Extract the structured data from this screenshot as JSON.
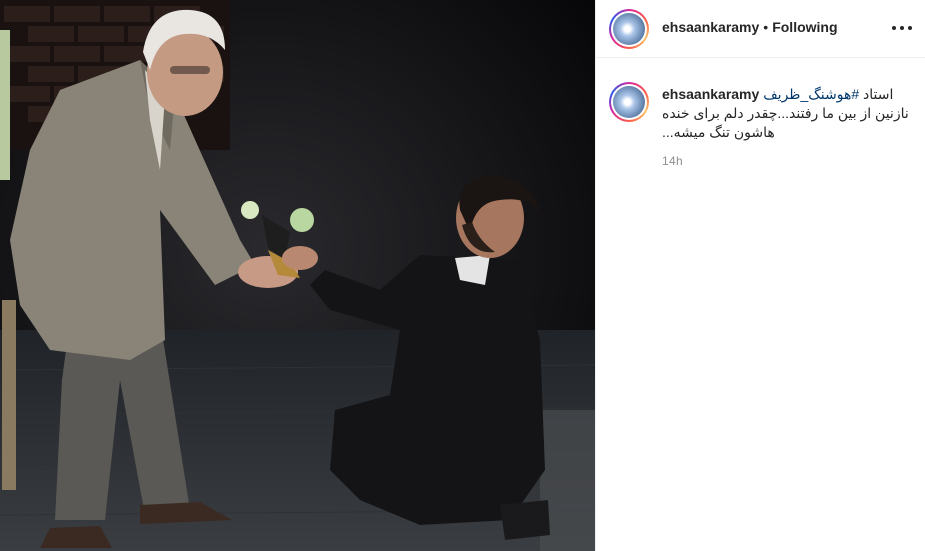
{
  "photo": {
    "alt_icon": "post-photo"
  },
  "header": {
    "username": "ehsaankaramy",
    "separator": "•",
    "follow_status": "Following",
    "more_icon": "more-options-icon"
  },
  "comment": {
    "username": "ehsaankaramy",
    "caption_prefix": "استاد",
    "hashtag": "#هوشنگ_ظریف",
    "caption_line2": "نازنین از بین ما رفتند...چقدر دلم برای خنده",
    "caption_line3": "هاشون تنگ میشه...",
    "timestamp": "14h"
  },
  "colors": {
    "hashtag": "#00376b",
    "muted": "#8e8e8e",
    "text": "#262626"
  }
}
